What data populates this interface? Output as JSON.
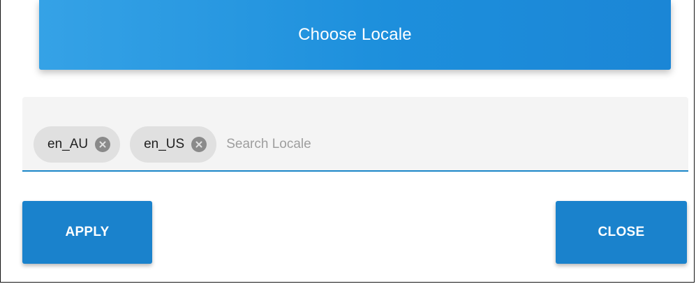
{
  "dialog": {
    "title": "Choose Locale"
  },
  "locale_field": {
    "chips": [
      {
        "label": "en_AU",
        "remove_icon": "close-circle-icon"
      },
      {
        "label": "en_US",
        "remove_icon": "close-circle-icon"
      }
    ],
    "search_placeholder": "Search Locale",
    "search_value": ""
  },
  "actions": {
    "apply_label": "APPLY",
    "close_label": "CLOSE"
  },
  "colors": {
    "header_gradient_start": "#35a2e6",
    "header_gradient_end": "#1b86d6",
    "button": "#1a82cc",
    "field_underline": "#1a86c8",
    "chip_background": "#e0e0e0"
  }
}
